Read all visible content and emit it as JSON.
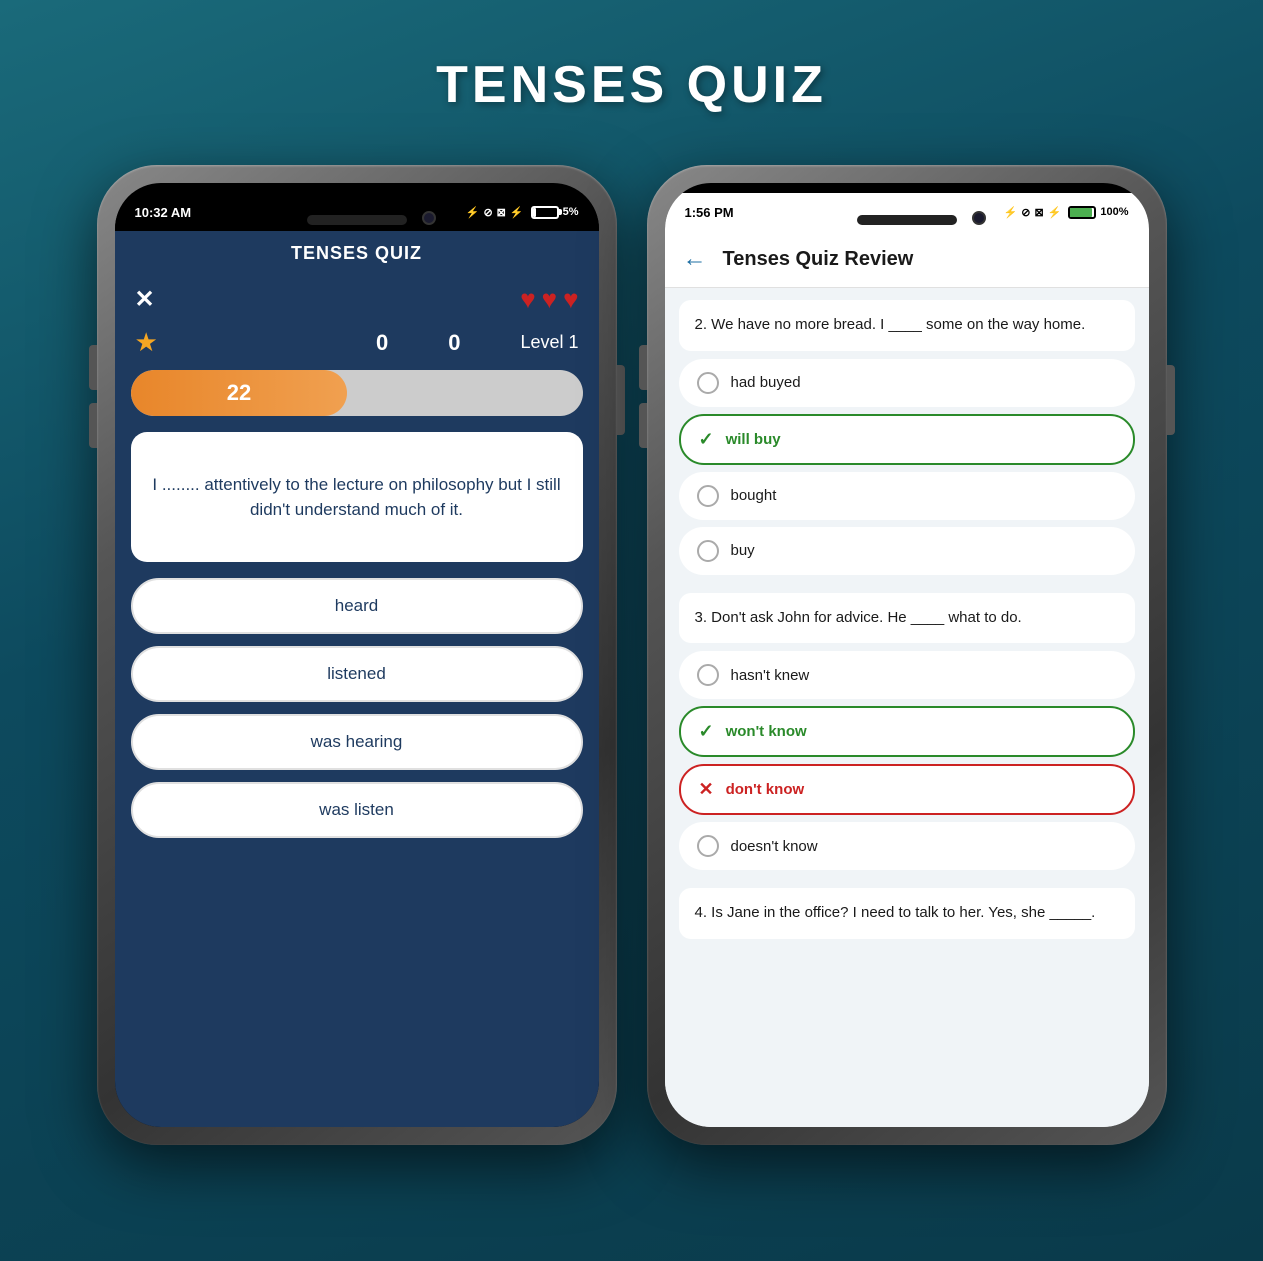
{
  "page": {
    "title": "TENSES QUIZ",
    "background": "teal-gradient"
  },
  "phone1": {
    "status_bar": {
      "time": "10:32 AM",
      "battery_percent": "5%",
      "battery_level": "low"
    },
    "app_title": "TENSES QUIZ",
    "close_button": "×",
    "hearts": [
      "♥",
      "♥",
      "♥"
    ],
    "score1": "0",
    "score2": "0",
    "level": "Level 1",
    "progress_number": "22",
    "question": "I ........ attentively to the lecture on philosophy but I still didn't understand much of it.",
    "answers": [
      "heard",
      "listened",
      "was hearing",
      "was listen"
    ]
  },
  "phone2": {
    "status_bar": {
      "time": "1:56 PM",
      "battery_percent": "100%",
      "battery_level": "full"
    },
    "back_button": "←",
    "review_title": "Tenses Quiz Review",
    "questions": [
      {
        "prompt": "2. We have no more bread. I ____ some on the way home.",
        "options": [
          {
            "text": "had buyed",
            "state": "neutral"
          },
          {
            "text": "will buy",
            "state": "correct"
          },
          {
            "text": "bought",
            "state": "neutral"
          },
          {
            "text": "buy",
            "state": "neutral"
          }
        ]
      },
      {
        "prompt": "3. Don't ask John for advice. He ____ what to do.",
        "options": [
          {
            "text": "hasn't knew",
            "state": "neutral"
          },
          {
            "text": "won't know",
            "state": "correct"
          },
          {
            "text": "don't know",
            "state": "wrong"
          },
          {
            "text": "doesn't know",
            "state": "neutral"
          }
        ]
      },
      {
        "prompt": "4. Is Jane in the office? I need to talk to her. Yes, she _____.",
        "options": []
      }
    ]
  },
  "icons": {
    "heart": "♥",
    "star": "★",
    "check": "✓",
    "cross": "✕",
    "back": "←",
    "close": "✕",
    "bluetooth": "⚡",
    "signal": "📶"
  }
}
